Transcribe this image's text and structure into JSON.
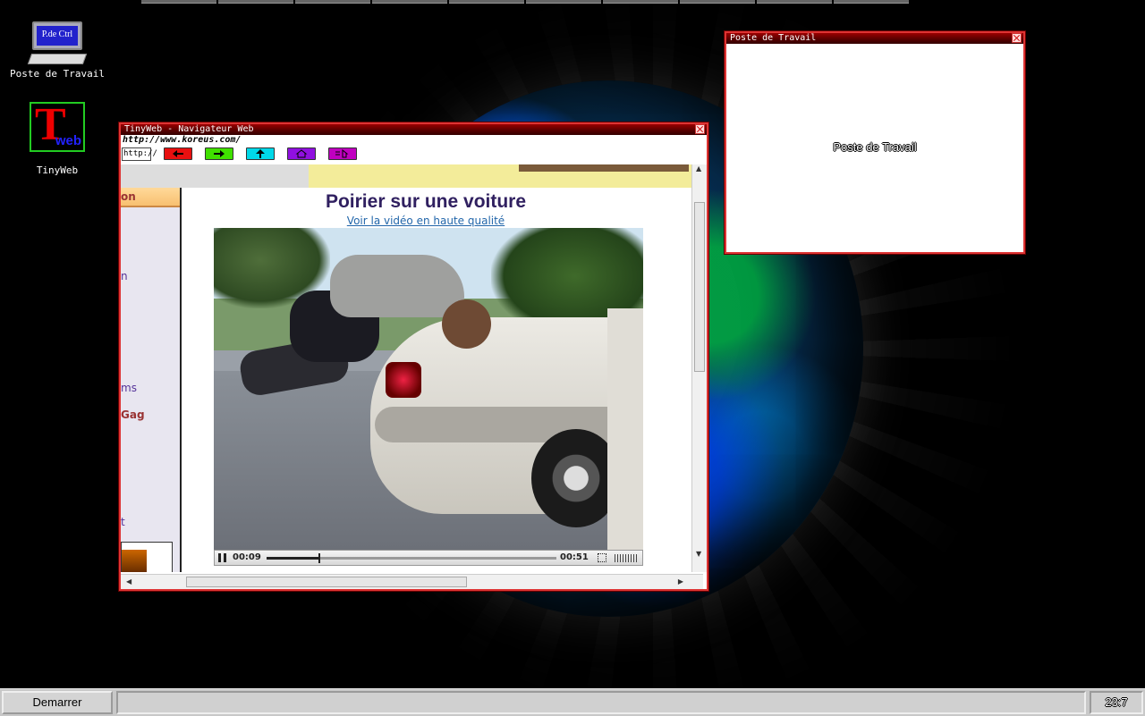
{
  "desktop": {
    "icons": [
      {
        "label": "Poste de Travail",
        "screen_text": "P.de Ctrl"
      },
      {
        "label": "TinyWeb",
        "logo_letter": "T",
        "logo_text": "web"
      }
    ]
  },
  "browser": {
    "title": "TinyWeb - Navigateur Web",
    "url": "http://www.koreus.com/",
    "address_label": "http://",
    "nav_buttons": [
      {
        "name": "back",
        "color": "#e81010"
      },
      {
        "name": "forward",
        "color": "#40e000"
      },
      {
        "name": "up",
        "color": "#00d8e8"
      },
      {
        "name": "home",
        "color": "#9010e0"
      },
      {
        "name": "favorites",
        "color": "#c000c0"
      }
    ],
    "page": {
      "sidebar_header": "on",
      "sidebar_links": [
        "n",
        "ms",
        "Gag",
        "t"
      ],
      "video_title": "Poirier sur une voiture",
      "hq_link": "Voir la vidéo en haute qualité",
      "player": {
        "current_time": "00:09",
        "duration": "00:51",
        "progress_fraction": 0.18
      }
    }
  },
  "info_window": {
    "title": "Poste de Travail",
    "body": "Poste de Travail"
  },
  "taskbar": {
    "start_label": "Demarrer",
    "clock": "23:7"
  }
}
